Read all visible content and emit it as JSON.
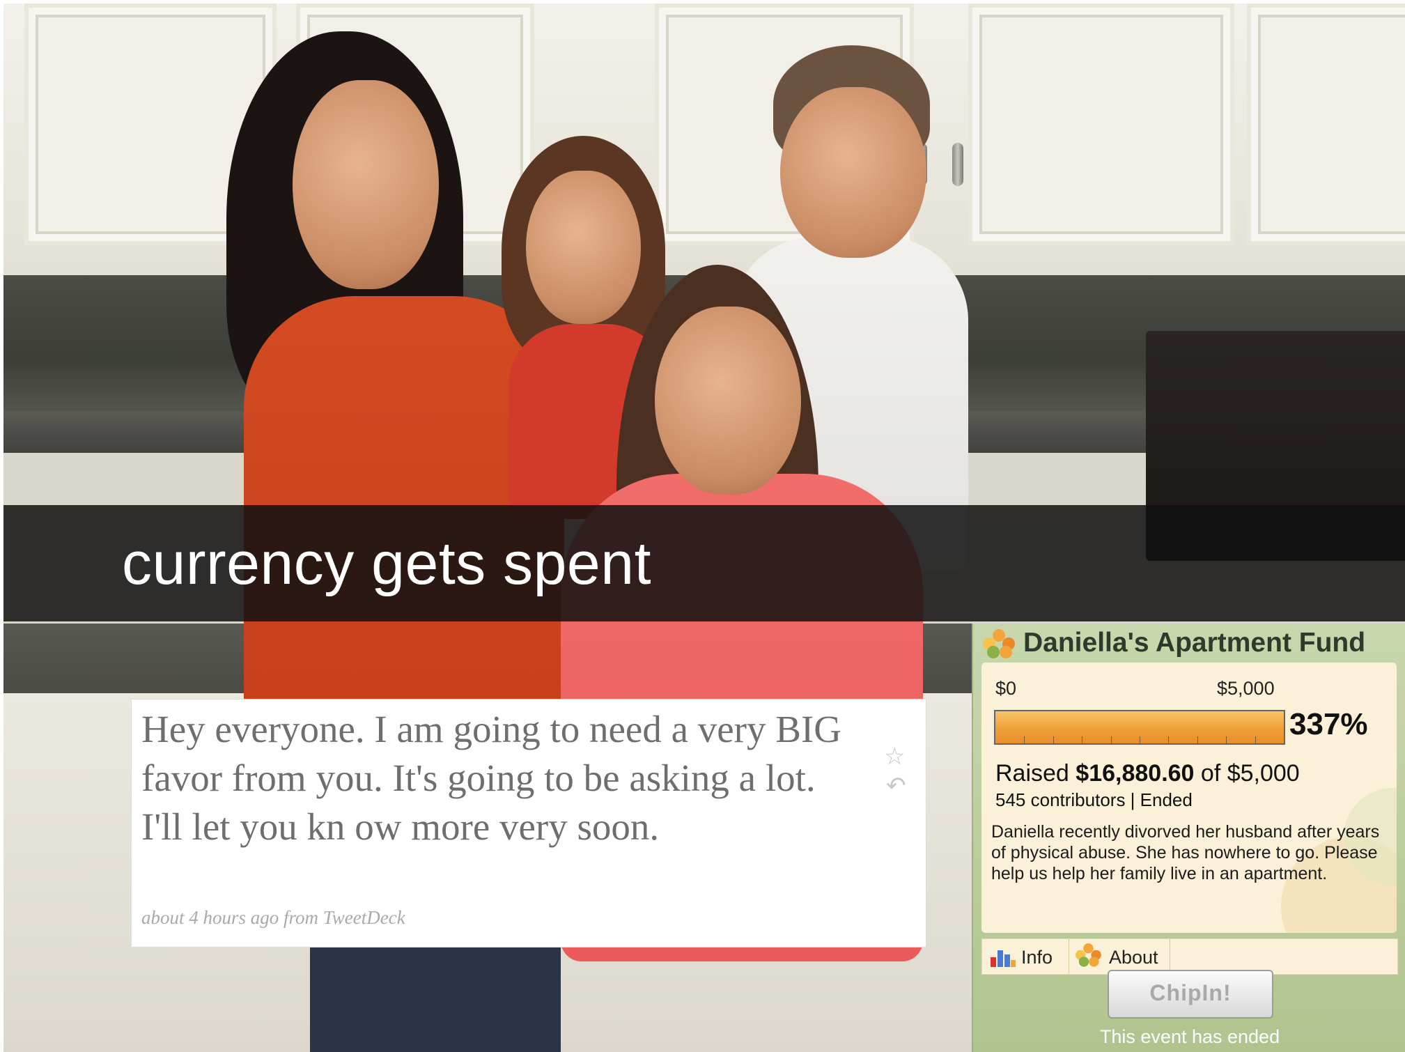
{
  "banner": {
    "title": "currency gets spent"
  },
  "tweet": {
    "text": "Hey everyone. I am going to need a very BIG favor from you. It's going to be asking a lot. I'll let you kn ow more very soon.",
    "meta": "about 4 hours ago from TweetDeck",
    "icons": [
      "star-icon",
      "reply-icon"
    ]
  },
  "chipin": {
    "title": "Daniella's Apartment Fund",
    "goal_min": "$0",
    "goal_max": "$5,000",
    "progress_fraction": 1.0,
    "percent": "337%",
    "raised_prefix": "Raised",
    "raised_amount": "$16,880.60",
    "raised_suffix": "of $5,000",
    "contributors": "545 contributors | Ended",
    "description": "Daniella recently divorved her husband after years of physical abuse. She has nowhere to go. Please help us help her family live in an apartment.",
    "tabs": [
      {
        "label": "Info",
        "icon": "bar-chart-icon"
      },
      {
        "label": "About",
        "icon": "flower-icon"
      }
    ],
    "button": "ChipIn!",
    "status": "This event has ended",
    "colors": {
      "bar": "#f0a23c",
      "widget_bg": "#bccc9c",
      "panel_bg": "#fbf1d8"
    }
  }
}
